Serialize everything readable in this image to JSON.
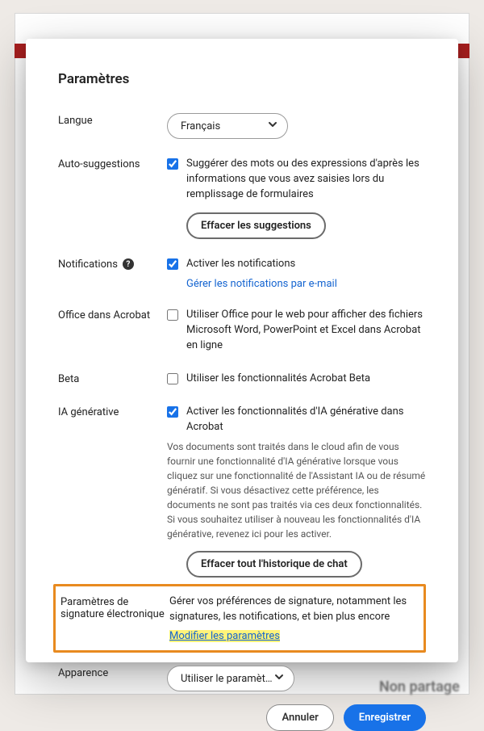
{
  "modal": {
    "title": "Paramètres"
  },
  "language": {
    "label": "Langue",
    "value": "Français"
  },
  "autosuggest": {
    "label": "Auto-suggestions",
    "checked": true,
    "text": "Suggérer des mots ou des expressions d'après les informations que vous avez saisies lors du remplissage de formulaires",
    "clear_btn": "Effacer les suggestions"
  },
  "notifications": {
    "label": "Notifications",
    "checked": true,
    "text": "Activer les notifications",
    "manage_link": "Gérer les notifications par e-mail"
  },
  "office": {
    "label": "Office dans Acrobat",
    "checked": false,
    "text": "Utiliser Office pour le web pour afficher des fichiers Microsoft Word, PowerPoint et Excel dans Acrobat en ligne"
  },
  "beta": {
    "label": "Beta",
    "checked": false,
    "text": "Utiliser les fonctionnalités Acrobat Beta"
  },
  "genai": {
    "label": "IA générative",
    "checked": true,
    "text": "Activer les fonctionnalités d'IA générative dans Acrobat",
    "fineprint": "Vos documents sont traités dans le cloud afin de vous fournir une fonctionnalité d'IA générative lorsque vous cliquez sur une fonctionnalité de l'Assistant IA ou de résumé génératif. Si vous désactivez cette préférence, les documents ne sont pas traités via ces deux fonctionnalités. Si vous souhaitez utiliser à nouveau les fonctionnalités d'IA générative, revenez ici pour les activer.",
    "clear_btn": "Effacer tout l'historique de chat"
  },
  "esign": {
    "label": "Paramètres de signature électronique",
    "text": "Gérer vos préférences de signature, notamment les signatures, les notifications, et bien plus encore",
    "link": "Modifier les paramètres"
  },
  "appearance": {
    "label": "Apparence",
    "value": "Utiliser le paramètre sy…"
  },
  "footer": {
    "cancel": "Annuler",
    "save": "Enregistrer"
  },
  "bg_text": "Non partage"
}
